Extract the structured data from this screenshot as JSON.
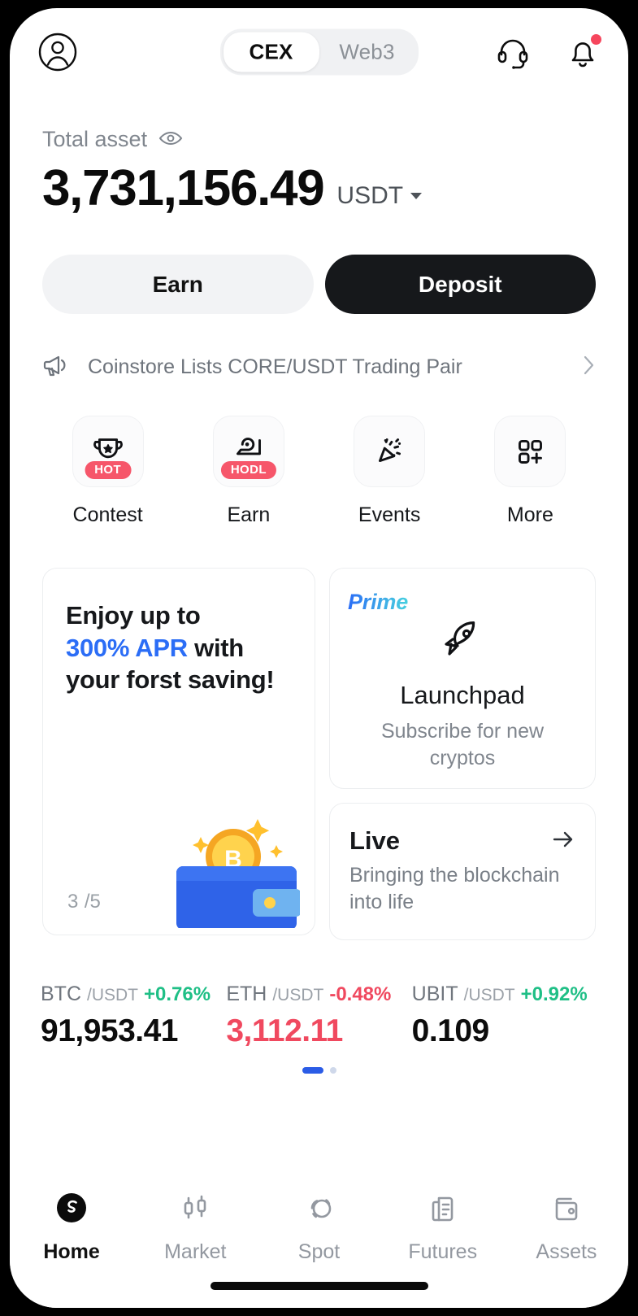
{
  "header": {
    "avatar_icon": "user-circle-icon",
    "segments": [
      {
        "label": "CEX",
        "active": true
      },
      {
        "label": "Web3",
        "active": false
      }
    ],
    "support_icon": "headset-icon",
    "notification_icon": "bell-icon",
    "has_notification_dot": true
  },
  "balance": {
    "label": "Total asset",
    "eye_icon": "eye-icon",
    "amount": "3,731,156.49",
    "currency": "USDT"
  },
  "actions": {
    "earn_label": "Earn",
    "deposit_label": "Deposit"
  },
  "announcement": {
    "icon": "megaphone-icon",
    "text": "Coinstore Lists CORE/USDT Trading Pair",
    "chevron_icon": "chevron-right-icon"
  },
  "quick_actions": [
    {
      "label": "Contest",
      "icon": "trophy-icon",
      "badge": "HOT"
    },
    {
      "label": "Earn",
      "icon": "piggy-save-icon",
      "badge": "HODL"
    },
    {
      "label": "Events",
      "icon": "confetti-icon",
      "badge": ""
    },
    {
      "label": "More",
      "icon": "grid-plus-icon",
      "badge": ""
    }
  ],
  "promo_card": {
    "line1": "Enjoy up to",
    "highlight": "300% APR",
    "line2_rest": " with",
    "line3": "your forst saving!",
    "counter_current": "3",
    "counter_total": "/5",
    "art_icon": "wallet-bitcoin-illustration"
  },
  "launchpad_card": {
    "tag": "Prime",
    "icon": "rocket-icon",
    "title": "Launchpad",
    "subtitle": "Subscribe for new cryptos"
  },
  "live_card": {
    "title": "Live",
    "arrow_icon": "arrow-right-icon",
    "subtitle": "Bringing the blockchain into life"
  },
  "tickers": [
    {
      "base": "BTC",
      "quote": "/USDT",
      "change": "+0.76%",
      "direction": "up",
      "price": "91,953.41"
    },
    {
      "base": "ETH",
      "quote": "/USDT",
      "change": "-0.48%",
      "direction": "down",
      "price": "3,112.11"
    },
    {
      "base": "UBIT",
      "quote": "/USDT",
      "change": "+0.92%",
      "direction": "up",
      "price": "0.109"
    }
  ],
  "pagination": {
    "total": 2,
    "active_index": 0
  },
  "bottom_nav": [
    {
      "label": "Home",
      "icon": "coinstore-logo-icon",
      "active": true
    },
    {
      "label": "Market",
      "icon": "candlestick-icon",
      "active": false
    },
    {
      "label": "Spot",
      "icon": "spot-circles-icon",
      "active": false
    },
    {
      "label": "Futures",
      "icon": "document-chart-icon",
      "active": false
    },
    {
      "label": "Assets",
      "icon": "wallet-icon",
      "active": false
    }
  ],
  "colors": {
    "accent_blue": "#2b6df6",
    "positive_green": "#1fbf86",
    "negative_red": "#f0495f",
    "badge_red": "#f6566a",
    "dark": "#16181b"
  }
}
